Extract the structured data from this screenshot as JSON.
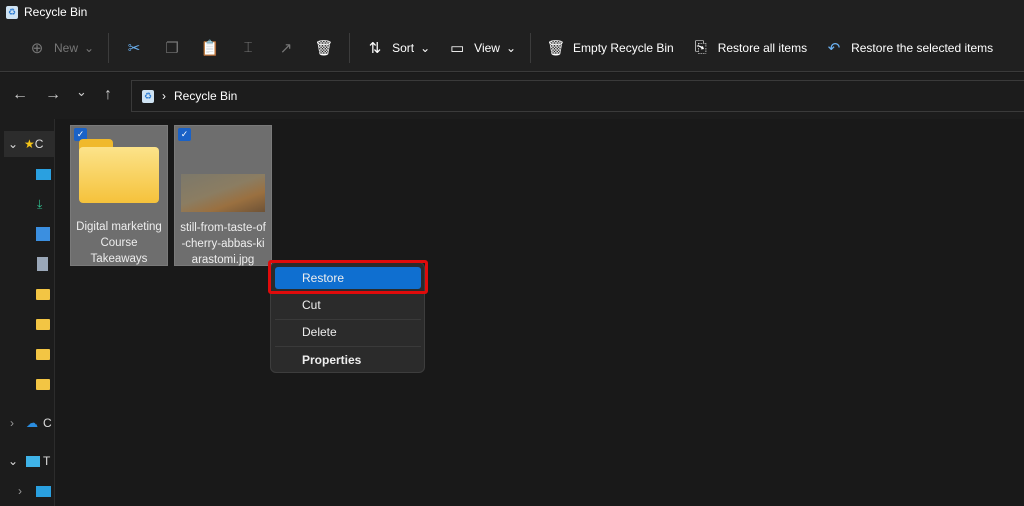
{
  "window": {
    "title": "Recycle Bin"
  },
  "toolbar": {
    "new": "New",
    "sort": "Sort",
    "view": "View",
    "empty": "Empty Recycle Bin",
    "restore_all": "Restore all items",
    "restore_selected": "Restore the selected items"
  },
  "address": {
    "location": "Recycle Bin"
  },
  "sidebar": {
    "quick_access": "C",
    "onedrive": "C",
    "this_pc": "T"
  },
  "items": [
    {
      "name": "Digital marketing Course Takeaways",
      "type": "folder",
      "selected": true
    },
    {
      "name": "still-from-taste-of-cherry-abbas-kiarastomi.jpg",
      "type": "image",
      "selected": true
    }
  ],
  "context_menu": {
    "items": [
      "Restore",
      "Cut",
      "Delete",
      "Properties"
    ]
  },
  "colors": {
    "accent": "#0f6fd0",
    "highlight": "#e00b0b"
  }
}
